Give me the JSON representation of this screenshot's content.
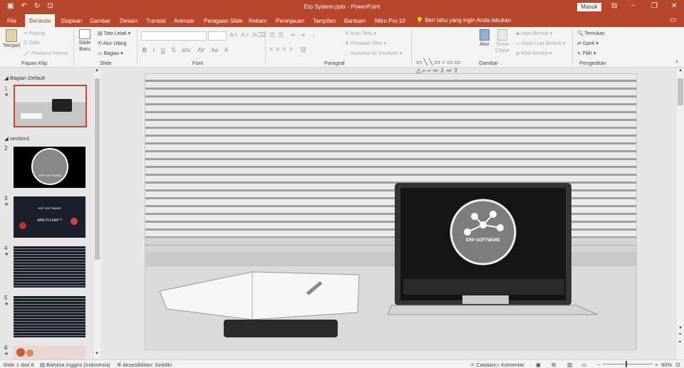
{
  "window": {
    "title": "Erp System.pptx  -  PowerPoint",
    "sign_in": "Masuk",
    "qat_icons": [
      "save-icon",
      "undo-icon",
      "redo-icon",
      "start-from-beginning-icon"
    ],
    "controls": [
      "ribbon-display-options-icon",
      "minimize-icon",
      "maximize-icon",
      "close-icon"
    ]
  },
  "tabs": [
    {
      "label": "File"
    },
    {
      "label": "Beranda",
      "active": true
    },
    {
      "label": "Sisipkan"
    },
    {
      "label": "Gambar"
    },
    {
      "label": "Desain"
    },
    {
      "label": "Transisi"
    },
    {
      "label": "Animasi"
    },
    {
      "label": "Peragaan Slide"
    },
    {
      "label": "Rekam"
    },
    {
      "label": "Peninjauan"
    },
    {
      "label": "Tampilan"
    },
    {
      "label": "Bantuan"
    },
    {
      "label": "Nitro Pro 10"
    }
  ],
  "tell_me": "Beri tahu yang ingin Anda lakukan",
  "ribbon": {
    "clipboard": {
      "label": "Papan Klip",
      "paste": "Tempel",
      "cut": "Potong",
      "copy": "Salin",
      "format_painter": "Pewarna Format"
    },
    "slides": {
      "label": "Slide",
      "new_slide": "Slide Baru",
      "layout": "Tata Letak",
      "reset": "Atur Ulang",
      "section": "Bagian"
    },
    "font": {
      "label": "Font",
      "styles": [
        "B",
        "I",
        "U",
        "S",
        "abc",
        "AV",
        "Aa",
        "A"
      ]
    },
    "paragraph": {
      "label": "Paragraf",
      "text_direction": "Arah Teks",
      "align_text": "Perataan Teks",
      "smartart": "Konversi ke SmartArt"
    },
    "drawing": {
      "label": "Gambar",
      "arrange": "Atur",
      "quick_styles": "Gaya Cepat",
      "shape_fill": "Isian Bentuk",
      "shape_outline": "Garis Luar Bentuk",
      "shape_effects": "Efek Bentuk"
    },
    "editing": {
      "label": "Pengeditan",
      "find": "Temukan",
      "replace": "Ganti",
      "select": "Pilih"
    }
  },
  "slides_panel": {
    "sections": [
      "Bagian Default",
      "section1"
    ],
    "thumbnails": [
      {
        "num": "1",
        "kind": "photo"
      },
      {
        "num": "2",
        "kind": "logo",
        "caption": "ERP SOFTWARE"
      },
      {
        "num": "3",
        "kind": "collage",
        "caption1": "ERP SOFTWARE",
        "caption2": "APA ITU ERP ?"
      },
      {
        "num": "4",
        "kind": "text"
      },
      {
        "num": "5",
        "kind": "text"
      },
      {
        "num": "6",
        "kind": "partial"
      }
    ]
  },
  "slide": {
    "laptop_logo_text": "ERP SOFTWARE"
  },
  "status": {
    "slide_count": "Slide 1 dari 8",
    "language": "Bahasa Inggris (Indonesia)",
    "accessibility": "Aksesibilitas: Selidiki",
    "notes": "Catatan",
    "comments": "Komentar",
    "zoom": "90%",
    "zoom_level": 0.9
  }
}
